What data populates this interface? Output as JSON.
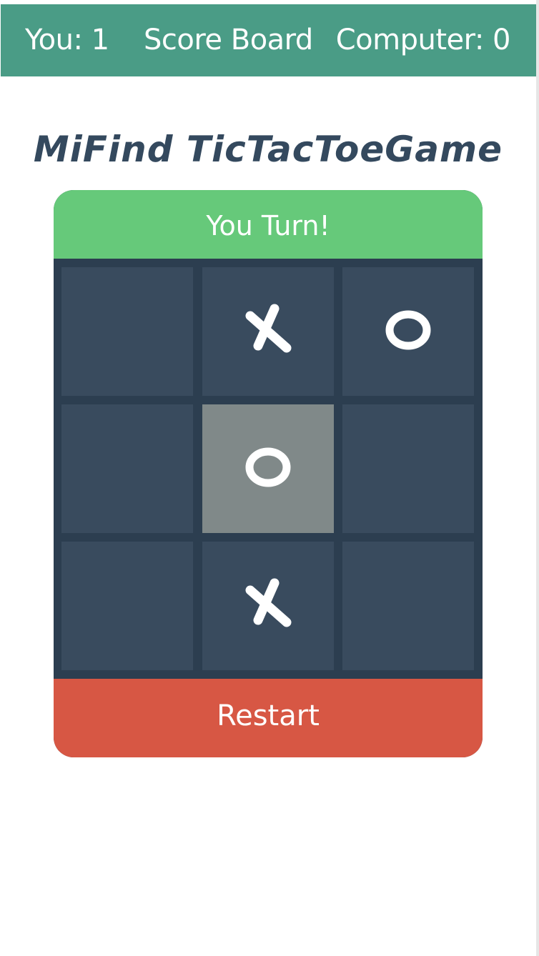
{
  "scoreboard": {
    "you": "You: 1",
    "title": "Score Board",
    "computer": "Computer: 0"
  },
  "game": {
    "title": "MiFind TicTacToeGame",
    "turn": "You Turn!",
    "restart_label": "Restart"
  },
  "board": {
    "cells": [
      "",
      "X",
      "O",
      "",
      "O",
      "",
      "",
      "X",
      ""
    ],
    "highlighted_cell": 4
  },
  "colors": {
    "header": "#4a9c86",
    "title": "#34495e",
    "turn_banner": "#66c97a",
    "cell": "#394b5e",
    "cell_highlight": "#808989",
    "grid_bg": "#2c3e50",
    "restart": "#d75744"
  }
}
